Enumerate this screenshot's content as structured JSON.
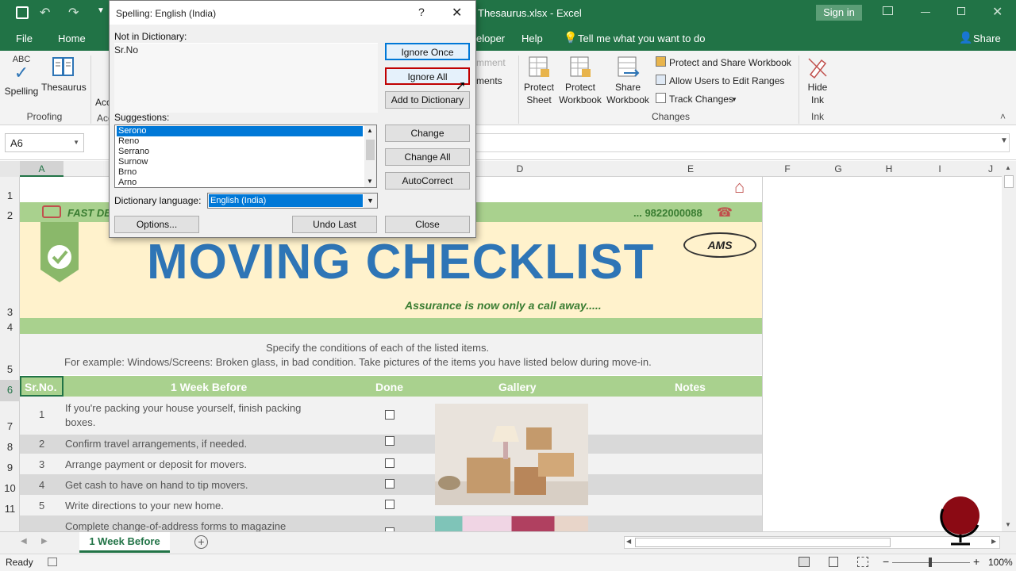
{
  "window": {
    "title": "Thesaurus.xlsx  -  Excel",
    "sign_in": "Sign in"
  },
  "ribbon_tabs": [
    "File",
    "Home",
    "eloper",
    "Help"
  ],
  "tell_me": "Tell me what you want to do",
  "share": "Share",
  "ribbon": {
    "spelling": "Spelling",
    "thesaurus": "Thesaurus",
    "proofing": "Proofing",
    "acc_partial": "Acc",
    "acc_partial2": "Acc",
    "comment_partial": "mment",
    "comments_partial": "ments",
    "protect_sheet": [
      "Protect",
      "Sheet"
    ],
    "protect_workbook": [
      "Protect",
      "Workbook"
    ],
    "share_workbook": [
      "Share",
      "Workbook"
    ],
    "protect_share": "Protect and Share Workbook",
    "allow_users": "Allow Users to Edit Ranges",
    "track_changes": "Track Changes",
    "changes": "Changes",
    "hide_ink": [
      "Hide",
      "Ink"
    ],
    "ink": "Ink"
  },
  "name_box": "A6",
  "columns": [
    "A",
    "D",
    "E",
    "F",
    "G",
    "H",
    "I",
    "J"
  ],
  "rows": [
    "1",
    "2",
    "3",
    "4",
    "5",
    "6",
    "7",
    "8",
    "9",
    "10",
    "11"
  ],
  "sheet": {
    "fast_partial": "FAST DE",
    "phone": "... 9822000088",
    "title": "MOVING CHECKLIST",
    "tagline": "Assurance is now only a call away.....",
    "instr1": "Specify the conditions of each of the listed items.",
    "instr2": "For example: Windows/Screens: Broken glass, in bad condition. Take pictures of the items you have listed below during move-in.",
    "headers": {
      "srno": "Sr.No.",
      "week": "1 Week Before",
      "done": "Done",
      "gallery": "Gallery",
      "notes": "Notes"
    },
    "items": [
      {
        "no": "1",
        "text1": "If you're packing your house yourself, finish packing",
        "text2": "boxes."
      },
      {
        "no": "2",
        "text1": "Confirm travel arrangements, if needed.",
        "text2": ""
      },
      {
        "no": "3",
        "text1": "Arrange payment or deposit for movers.",
        "text2": ""
      },
      {
        "no": "4",
        "text1": "Get cash to have on hand to tip movers.",
        "text2": ""
      },
      {
        "no": "5",
        "text1": "Write directions to your new home.",
        "text2": ""
      },
      {
        "no": "",
        "text1": "Complete change-of-address forms to magazine",
        "text2": ""
      }
    ]
  },
  "sheet_tab": "1 Week Before",
  "status": {
    "ready": "Ready",
    "zoom": "100%"
  },
  "dialog": {
    "title": "Spelling: English (India)",
    "help": "?",
    "not_in_dict_label": "Not in Dictionary:",
    "not_in_dict_value": "Sr.No",
    "suggestions_label": "Suggestions:",
    "suggestions": [
      "Serono",
      "Reno",
      "Serrano",
      "Surnow",
      "Brno",
      "Arno"
    ],
    "dict_lang_label": "Dictionary language:",
    "dict_lang_value": "English (India)",
    "buttons": {
      "ignore_once": "Ignore Once",
      "ignore_all": "Ignore All",
      "add_dict": "Add to Dictionary",
      "change": "Change",
      "change_all": "Change All",
      "autocorrect": "AutoCorrect",
      "options": "Options...",
      "undo_last": "Undo Last",
      "close": "Close"
    }
  },
  "colors": {
    "excel_green": "#217346",
    "band_green": "#a9d18e",
    "cream": "#fff2cc",
    "title_blue": "#2e75b6",
    "highlight": "#c00000"
  },
  "logo_text": "AMS"
}
